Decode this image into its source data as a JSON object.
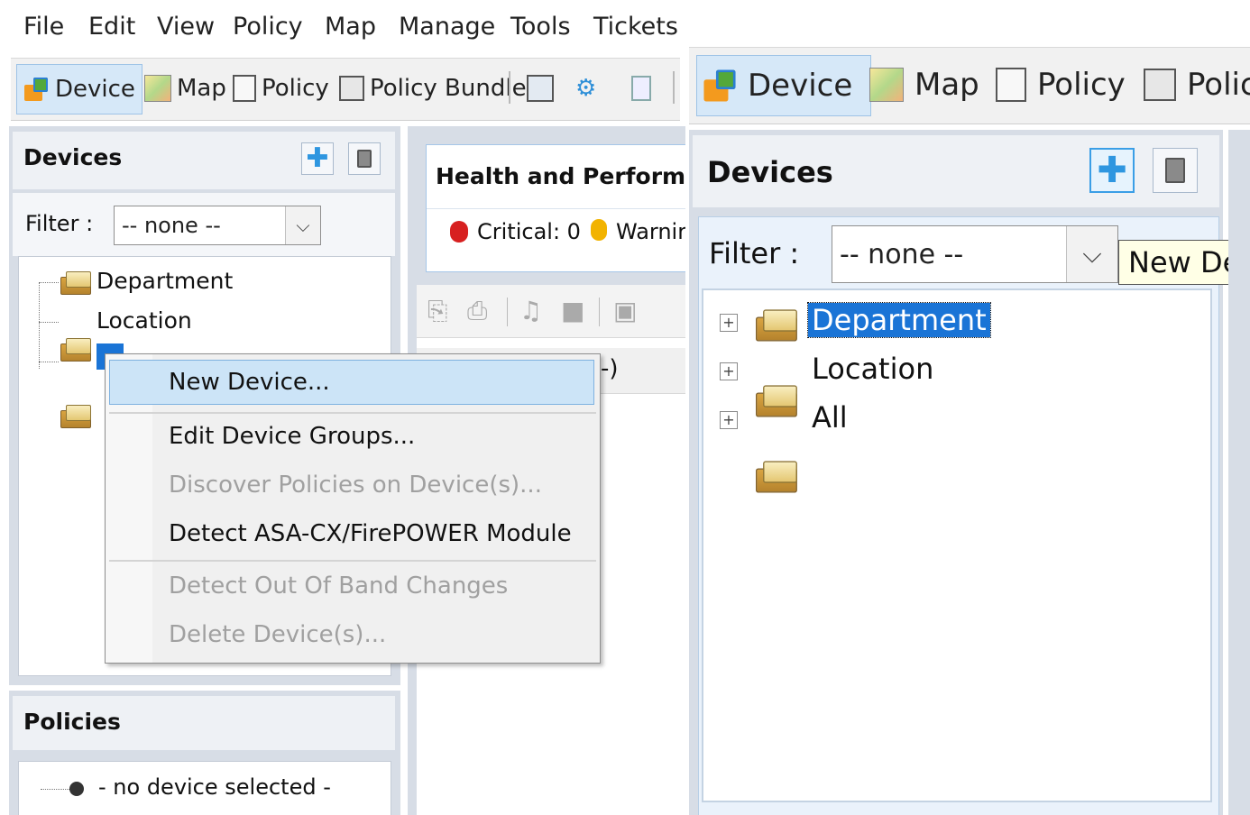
{
  "menu": [
    "File",
    "Edit",
    "View",
    "Policy",
    "Map",
    "Manage",
    "Tools",
    "Tickets"
  ],
  "toolbar": {
    "device": "Device",
    "map": "Map",
    "policy": "Policy",
    "policy_bundle": "Policy Bundle"
  },
  "devices_panel": {
    "title": "Devices",
    "filter_label": "Filter :",
    "filter_value": "-- none --",
    "tree": [
      "Department",
      "Location",
      "All"
    ]
  },
  "health_panel": {
    "title": "Health and Performan",
    "critical": "Critical: 0",
    "warning": "Warnir"
  },
  "context_menu": {
    "items": [
      {
        "label": "New Device...",
        "enabled": true
      },
      {
        "label": "Edit Device Groups...",
        "enabled": true
      },
      {
        "label": "Discover Policies on Device(s)...",
        "enabled": false
      },
      {
        "label": "Detect ASA-CX/FirePOWER Module",
        "enabled": true
      },
      {
        "label": "Detect Out Of Band Changes",
        "enabled": false
      },
      {
        "label": "Delete Device(s)...",
        "enabled": false
      }
    ]
  },
  "policies_panel": {
    "title": "Policies",
    "empty": "- no device selected -"
  },
  "right": {
    "toolbar": {
      "device": "Device",
      "map": "Map",
      "policy": "Policy",
      "policy_cut": "Polic"
    },
    "devices_title": "Devices",
    "filter_label": "Filter :",
    "filter_value": "-- none --",
    "tooltip": "New Dev",
    "tree": [
      "Department",
      "Location",
      "All"
    ]
  },
  "fragment_paren": "-)",
  "colors": {
    "selection": "#1a74d6",
    "toolbar_active": "#d6e8f8",
    "accent_plus": "#2e96e0"
  }
}
